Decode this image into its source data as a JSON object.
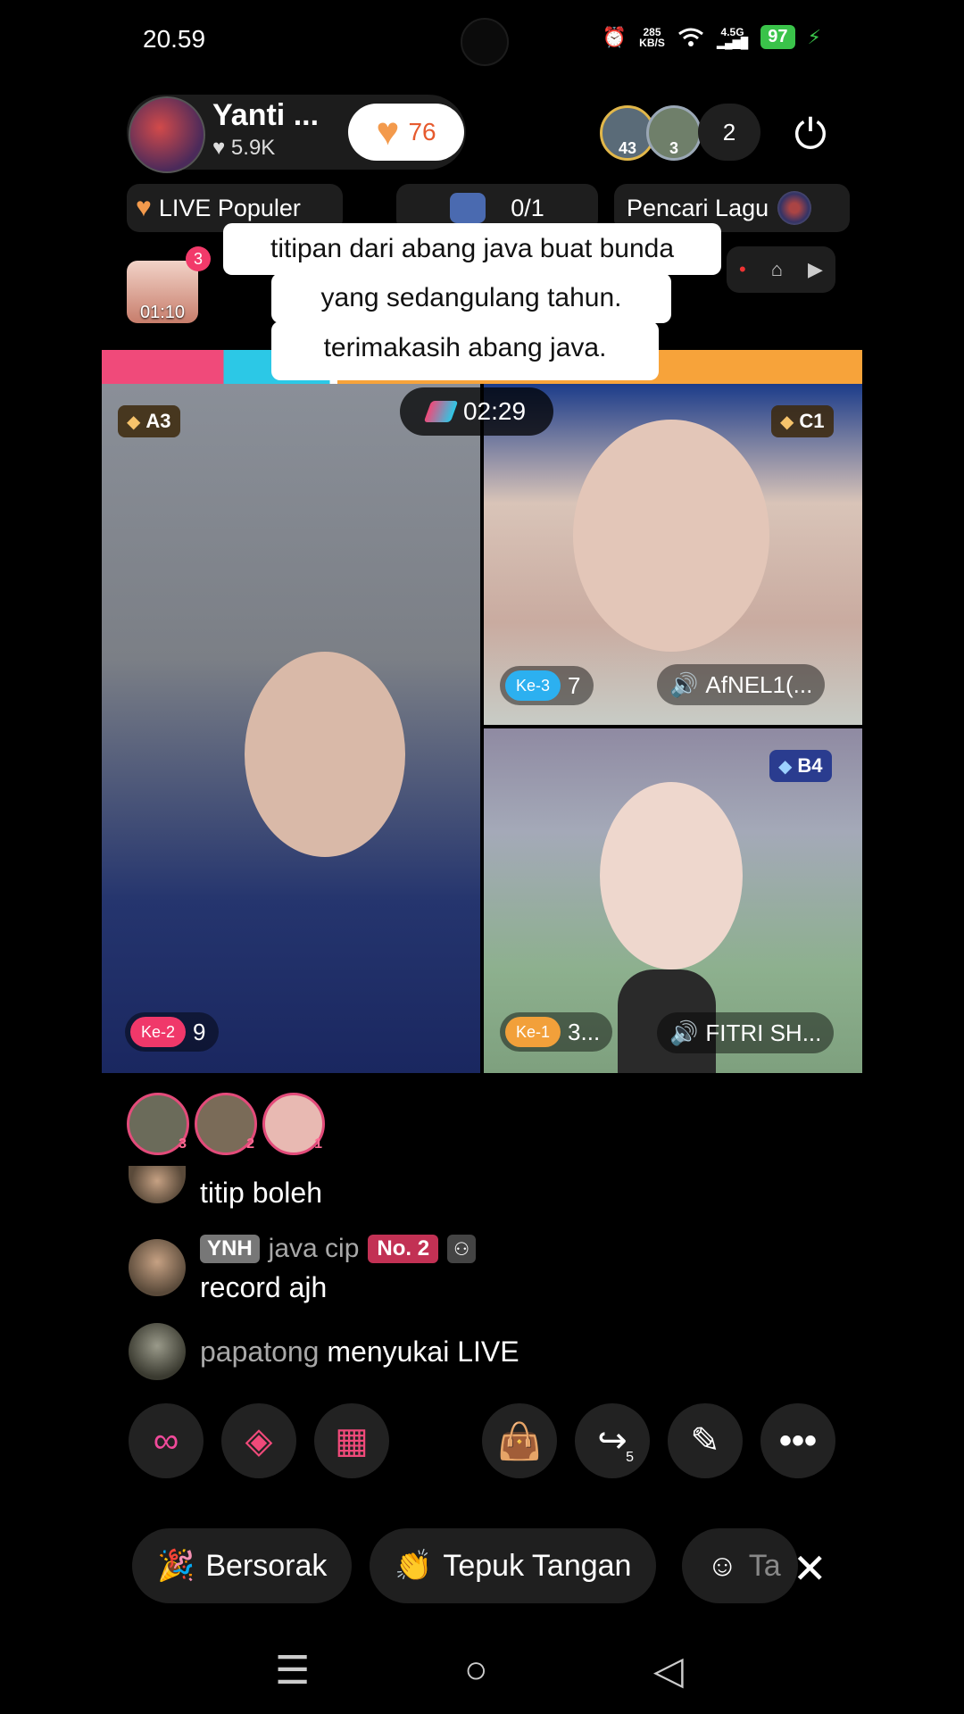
{
  "status": {
    "time": "20.59",
    "net_speed_top": "285",
    "net_speed_bottom": "KB/S",
    "network": "4.5G",
    "battery": "97"
  },
  "host": {
    "name": "Yanti ...",
    "likes": "5.9K",
    "like_button_count": "76"
  },
  "viewers": {
    "avatars": [
      {
        "badge": "43"
      },
      {
        "badge": "3"
      }
    ],
    "count": "2"
  },
  "top_chips": {
    "live_popular": "LIVE Populer",
    "score": "0/1",
    "song_search": "Pencari Lagu"
  },
  "gift": {
    "badge": "3",
    "timer": "01:10"
  },
  "caption": {
    "line1": "titipan dari abang java buat bunda",
    "line2": "yang sedangulang tahun.",
    "line3": "terimakasih abang java."
  },
  "battle": {
    "timer": "02:29",
    "players": [
      {
        "rank": "A3",
        "position": "Ke-2",
        "score": "9",
        "name": ""
      },
      {
        "rank": "C1",
        "position": "Ke-3",
        "score": "7",
        "name": "AfNEL1(..."
      },
      {
        "rank": "B4",
        "position": "Ke-1",
        "score": "3...",
        "name": "FITRI SH..."
      }
    ],
    "colors": {
      "ke1": "#f2a03a",
      "ke2": "#f0386a",
      "ke3": "#2cb0f0"
    }
  },
  "top_gifters": [
    "3",
    "2",
    "1"
  ],
  "chat": [
    {
      "user": "",
      "text": "titip boleh"
    },
    {
      "level": "YNH",
      "user": "java cip",
      "rank_badge": "No. 2",
      "text": "record ajh"
    },
    {
      "user": "papatong",
      "text": "menyukai LIVE"
    }
  ],
  "actions": {
    "share_count": "5"
  },
  "reactions": {
    "cheer": "Bersorak",
    "clap": "Tepuk Tangan",
    "third": "Ta"
  },
  "icons": [
    "alarm-icon",
    "wifi-icon",
    "signal-icon",
    "battery-icon",
    "heart-icon",
    "power-icon",
    "disc-icon",
    "gift-box-icon",
    "home-icon",
    "play-icon",
    "battle-icon",
    "diamond-icon",
    "speaker-icon",
    "link-icon",
    "boxing-icon",
    "grid-icon",
    "shopping-bag-icon",
    "share-icon",
    "magic-wand-icon",
    "more-icon",
    "party-popper-icon",
    "clap-icon",
    "smile-icon",
    "close-icon",
    "menu-icon",
    "circle-home-icon",
    "back-icon"
  ]
}
